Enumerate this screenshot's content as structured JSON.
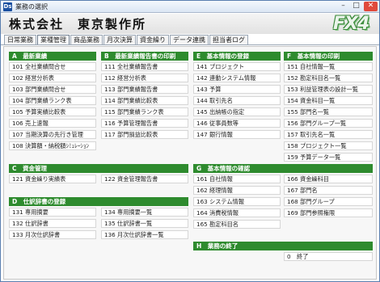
{
  "window": {
    "icon": "Ds",
    "title": "業務の選択",
    "min": "–",
    "max": "□",
    "close": "✕"
  },
  "header": {
    "company": "株式会社　東京製作所",
    "logo": "FX4"
  },
  "tabs": [
    "日常業務",
    "業種管理",
    "商品業務",
    "月次決算",
    "資金繰り",
    "データ連携",
    "担当者ログ"
  ],
  "active_tab": "業種管理",
  "sections": {
    "a": {
      "title": "A　最新業績",
      "items": [
        {
          "code": "101",
          "label": "全社業績問合せ"
        },
        {
          "code": "102",
          "label": "経営分析表"
        },
        {
          "code": "103",
          "label": "部門業績問合せ"
        },
        {
          "code": "104",
          "label": "部門業績ランク表"
        },
        {
          "code": "105",
          "label": "予算実績比較表"
        },
        {
          "code": "106",
          "label": "売上速報"
        },
        {
          "code": "107",
          "label": "当期決算の先行き管理"
        },
        {
          "code": "108",
          "label": "決算額・納税額ｼﾐｭﾚｰｼｮﾝ"
        }
      ]
    },
    "b": {
      "title": "B　最新業績報告書の印刷",
      "items": [
        {
          "code": "111",
          "label": "全社業績報告書"
        },
        {
          "code": "112",
          "label": "経営分析表"
        },
        {
          "code": "113",
          "label": "部門業績報告書"
        },
        {
          "code": "114",
          "label": "部門業績比較表"
        },
        {
          "code": "115",
          "label": "部門業績ランク表"
        },
        {
          "code": "116",
          "label": "予算管理報告書"
        },
        {
          "code": "117",
          "label": "部門損益比較表"
        }
      ]
    },
    "e": {
      "title": "E　基本情報の登録",
      "items": [
        {
          "code": "141",
          "label": "プロジェクト"
        },
        {
          "code": "142",
          "label": "連動システム情報"
        },
        {
          "code": "143",
          "label": "予算"
        },
        {
          "code": "144",
          "label": "取引先名"
        },
        {
          "code": "145",
          "label": "出納帳の指定"
        },
        {
          "code": "146",
          "label": "従事員数等"
        },
        {
          "code": "147",
          "label": "銀行情報"
        }
      ]
    },
    "f": {
      "title": "F　基本情報の印刷",
      "items": [
        {
          "code": "151",
          "label": "自社情報一覧"
        },
        {
          "code": "152",
          "label": "勘定科目名一覧"
        },
        {
          "code": "153",
          "label": "利益管理表の設計一覧"
        },
        {
          "code": "154",
          "label": "資金科目一覧"
        },
        {
          "code": "155",
          "label": "部門名一覧"
        },
        {
          "code": "156",
          "label": "部門グループ一覧"
        },
        {
          "code": "157",
          "label": "取引先名一覧"
        },
        {
          "code": "158",
          "label": "プロジェクト一覧"
        },
        {
          "code": "159",
          "label": "予算データ一覧"
        }
      ]
    },
    "c": {
      "title": "C　資金管理",
      "items": [
        {
          "code": "121",
          "label": "資金繰り実績表"
        },
        {
          "code": "122",
          "label": "資金管理報告書"
        }
      ]
    },
    "g": {
      "title": "G　基本情報の確認",
      "items": [
        {
          "code": "161",
          "label": "自社情報"
        },
        {
          "code": "162",
          "label": "経理情報"
        },
        {
          "code": "163",
          "label": "システム情報"
        },
        {
          "code": "164",
          "label": "消費税情報"
        },
        {
          "code": "165",
          "label": "勘定科目名"
        },
        {
          "code": "166",
          "label": "資金繰科目"
        },
        {
          "code": "167",
          "label": "部門名"
        },
        {
          "code": "168",
          "label": "部門グループ"
        },
        {
          "code": "169",
          "label": "部門参照権限"
        }
      ]
    },
    "d": {
      "title": "D　仕訳辞書の登録",
      "items": [
        {
          "code": "131",
          "label": "専用摘要"
        },
        {
          "code": "132",
          "label": "仕訳辞書"
        },
        {
          "code": "133",
          "label": "月次仕訳辞書"
        },
        {
          "code": "134",
          "label": "専用摘要一覧"
        },
        {
          "code": "135",
          "label": "仕訳辞書一覧"
        },
        {
          "code": "136",
          "label": "月次仕訳辞書一覧"
        }
      ]
    },
    "h": {
      "title": "H　業務の終了",
      "items": [
        {
          "code": "0",
          "label": "終了"
        }
      ]
    }
  }
}
